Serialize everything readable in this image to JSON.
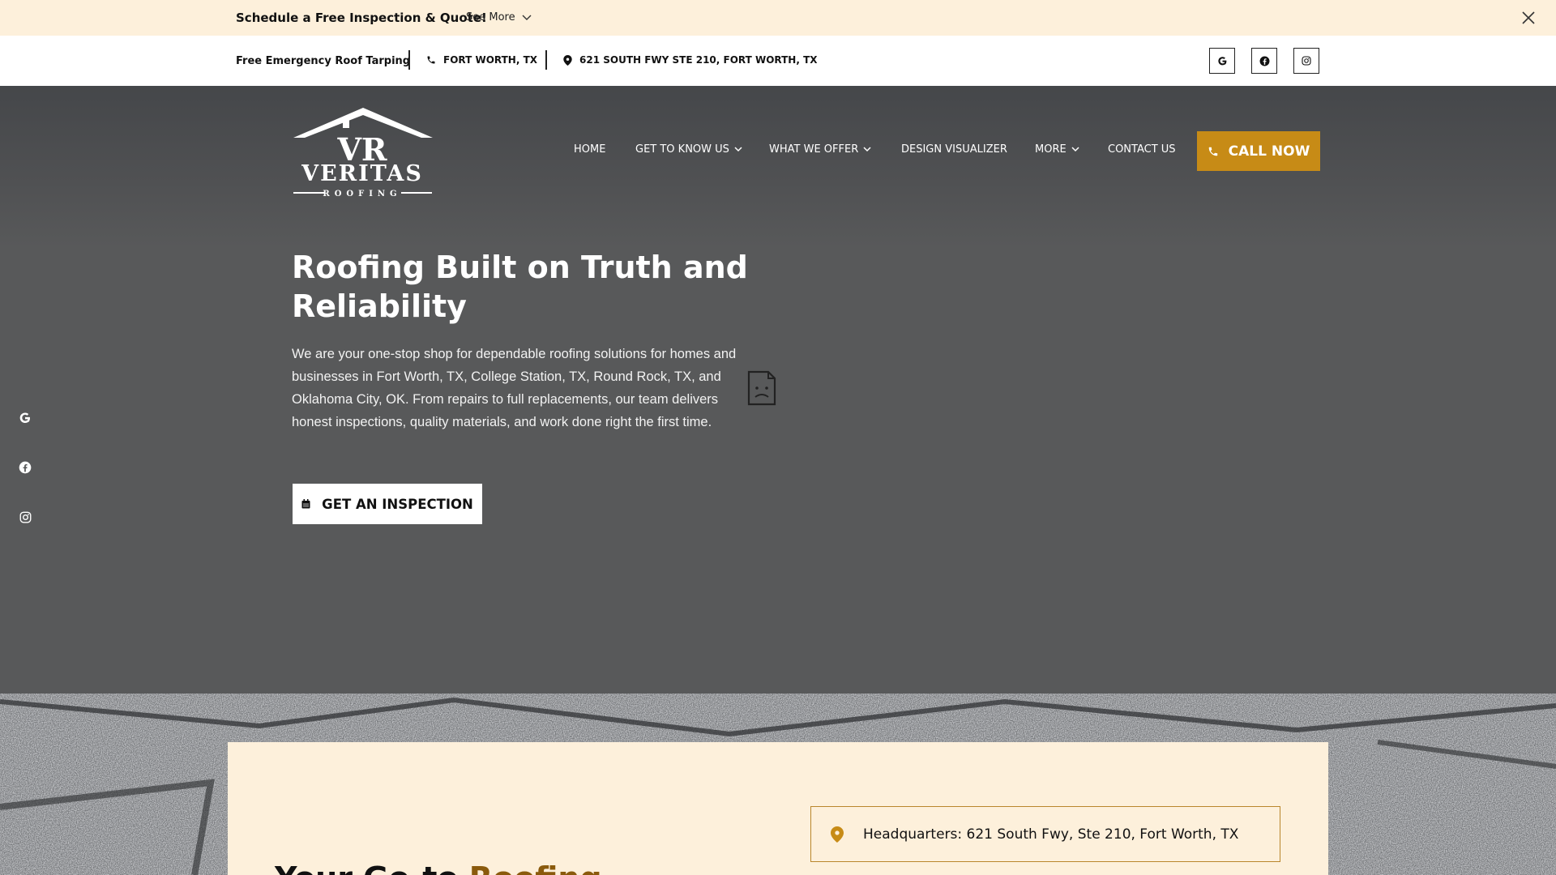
{
  "announcement": {
    "text": "Schedule a Free Inspection & Quote!",
    "see_more": "See More"
  },
  "topbar": {
    "tarping": "Free Emergency Roof Tarping",
    "phone_location": "FORT WORTH, TX",
    "address": "621 SOUTH FWY STE 210, FORT WORTH, TX",
    "social": [
      "google-icon",
      "facebook-icon",
      "instagram-icon"
    ]
  },
  "logo": {
    "monogram": "VR",
    "name": "VERITAS",
    "tagline": "ROOFING"
  },
  "nav": {
    "home": "HOME",
    "about": "GET TO KNOW US",
    "offer": "WHAT WE OFFER",
    "visualizer": "DESIGN VISUALIZER",
    "more": "MORE",
    "contact": "CONTACT US",
    "call": "CALL NOW"
  },
  "hero": {
    "title": "Roofing Built on Truth and Reliability",
    "description": "We are your one-stop shop for dependable roofing solutions for homes and businesses in Fort Worth, TX, College Station, TX, Round Rock, TX, and Oklahoma City, OK. From repairs to full replacements, our team delivers honest inspections, quality materials, and work done right the first time.",
    "cta": "GET AN INSPECTION"
  },
  "section": {
    "heading_part1": "Your Go-to ",
    "heading_accent": "Roofing",
    "headquarters": "Headquarters: 621 South Fwy, Ste 210, Fort Worth, TX"
  },
  "colors": {
    "accent": "#c78b16",
    "cream": "#fdf0db",
    "hero_bg": "#58595a"
  }
}
